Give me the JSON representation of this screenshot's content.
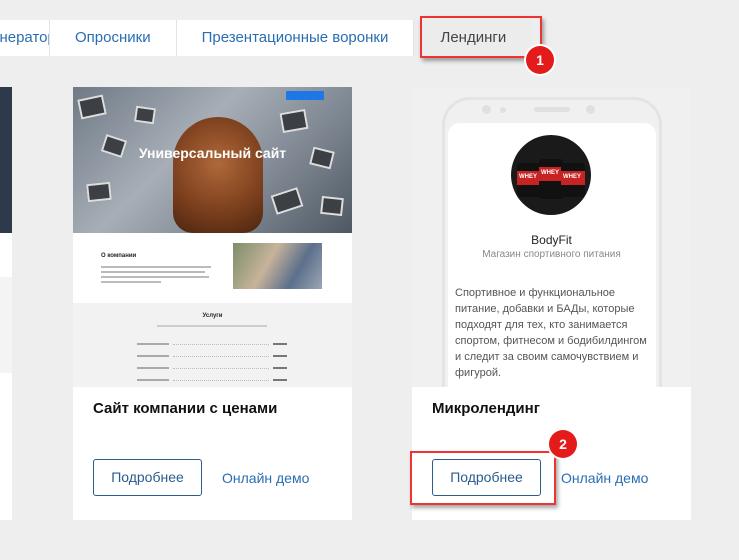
{
  "tabs": [
    {
      "label": "Генератор лидов",
      "active": false
    },
    {
      "label": "Опросники",
      "active": false
    },
    {
      "label": "Презентационные воронки",
      "active": false
    },
    {
      "label": "Лендинги",
      "active": true
    }
  ],
  "annotations": {
    "badge_1": "1",
    "badge_2": "2"
  },
  "cards": [
    {
      "title": "Сайт компании с ценами",
      "details_label": "Подробнее",
      "demo_label": "Онлайн демо",
      "preview": {
        "hero_title": "Универсальный сайт",
        "about_heading": "О компании",
        "services_heading": "Услуги"
      }
    },
    {
      "title": "Микролендинг",
      "details_label": "Подробнее",
      "demo_label": "Онлайн демо",
      "preview": {
        "name": "BodyFit",
        "subtitle": "Магазин спортивного питания",
        "description": "Спортивное и функциональное питание, добавки и БАДы, которые подходят для тех, кто занимается спортом, фитнесом и бодибилдингом и следит за своим самочувствием и фигурой.",
        "product_label": "WHEY"
      }
    }
  ],
  "colors": {
    "accent": "#2a6db3",
    "button_border": "#2a5c8e",
    "highlight": "#e33333"
  }
}
